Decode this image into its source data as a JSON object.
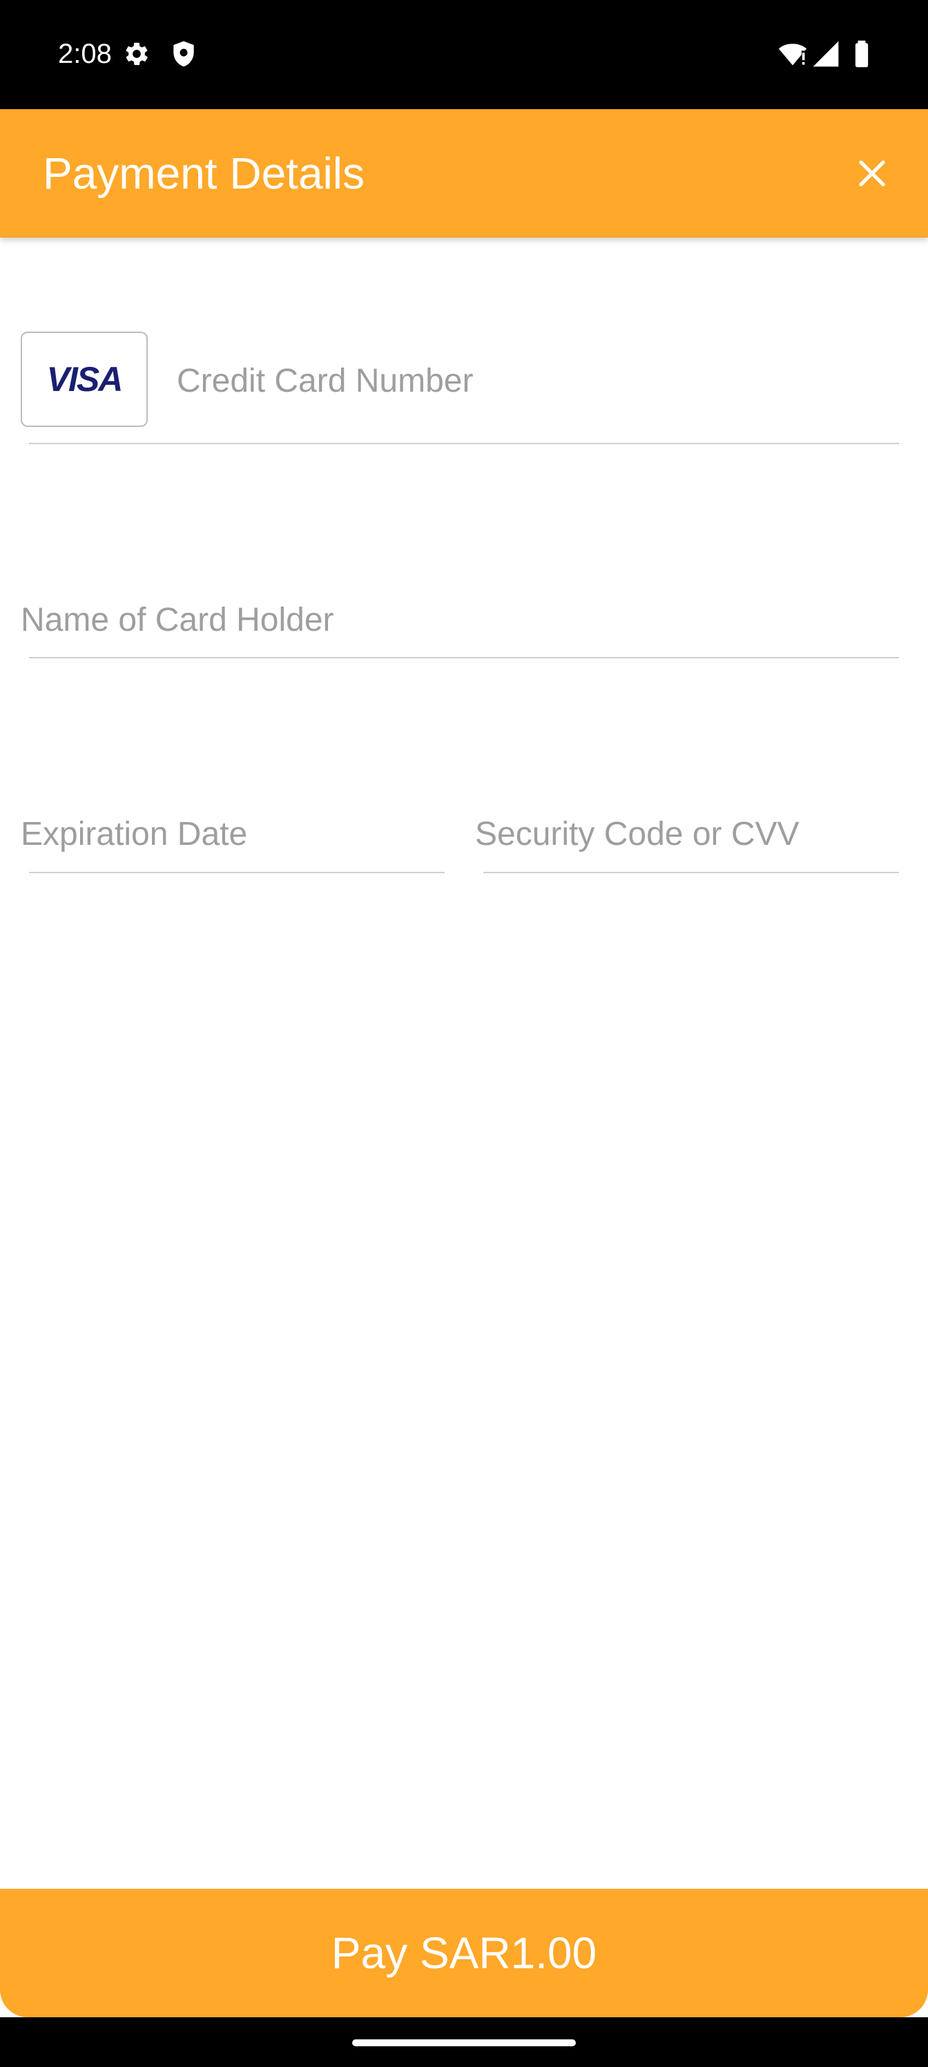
{
  "status_bar": {
    "time": "2:08",
    "icons": [
      "settings-icon",
      "shield-icon",
      "wifi-icon",
      "signal-icon",
      "battery-icon"
    ]
  },
  "header": {
    "title": "Payment Details",
    "close_icon": "close-icon",
    "background": "#FFA82A"
  },
  "form": {
    "card_brand": "VISA",
    "card_number": {
      "placeholder": "Credit Card Number",
      "value": ""
    },
    "card_holder": {
      "placeholder": "Name of Card Holder",
      "value": ""
    },
    "expiration": {
      "placeholder": "Expiration Date",
      "value": ""
    },
    "cvv": {
      "placeholder": "Security Code or CVV",
      "value": ""
    }
  },
  "pay_button": {
    "label": "Pay SAR1.00",
    "background": "#FFA82A"
  }
}
